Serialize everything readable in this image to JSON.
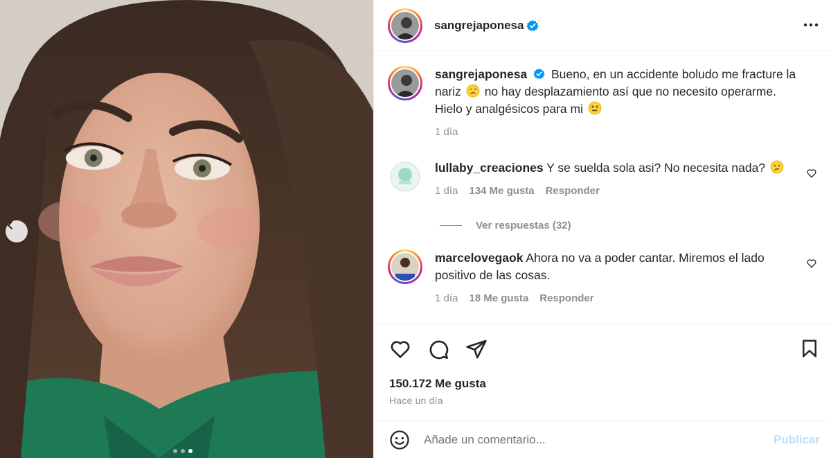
{
  "post": {
    "username": "sangrejaponesa",
    "verified": true,
    "carousel": {
      "slide_count": 3,
      "active_slide": 3
    }
  },
  "caption": {
    "username": "sangrejaponesa",
    "text_part1": "Bueno, en un accidente boludo me fracture la nariz",
    "text_part2": "no hay desplazamiento así que no necesito operarme. Hielo y analgésicos para mi",
    "time": "1 día"
  },
  "comments": [
    {
      "username": "lullaby_creaciones",
      "text": "Y se suelda sola asi? No necesita nada?",
      "time": "1 día",
      "likes": "134 Me gusta",
      "reply_label": "Responder"
    },
    {
      "username": "marcelovegaok",
      "text": "Ahora no va a poder cantar. Miremos el lado positivo de las cosas.",
      "time": "1 día",
      "likes": "18 Me gusta",
      "reply_label": "Responder"
    }
  ],
  "view_replies": "Ver respuestas (32)",
  "footer": {
    "likes": "150.172 Me gusta",
    "posted": "Hace un día",
    "comment_placeholder": "Añade un comentario...",
    "publish_label": "Publicar"
  },
  "icons": {
    "like": "heart-icon",
    "comment": "comment-icon",
    "share": "paper-plane-icon",
    "save": "bookmark-icon",
    "more": "more-options-icon",
    "emoji": "emoji-smile-icon"
  },
  "colors": {
    "verified": "#0095f6",
    "publish_disabled": "#c0dffd",
    "muted_text": "#8e8e8e"
  }
}
